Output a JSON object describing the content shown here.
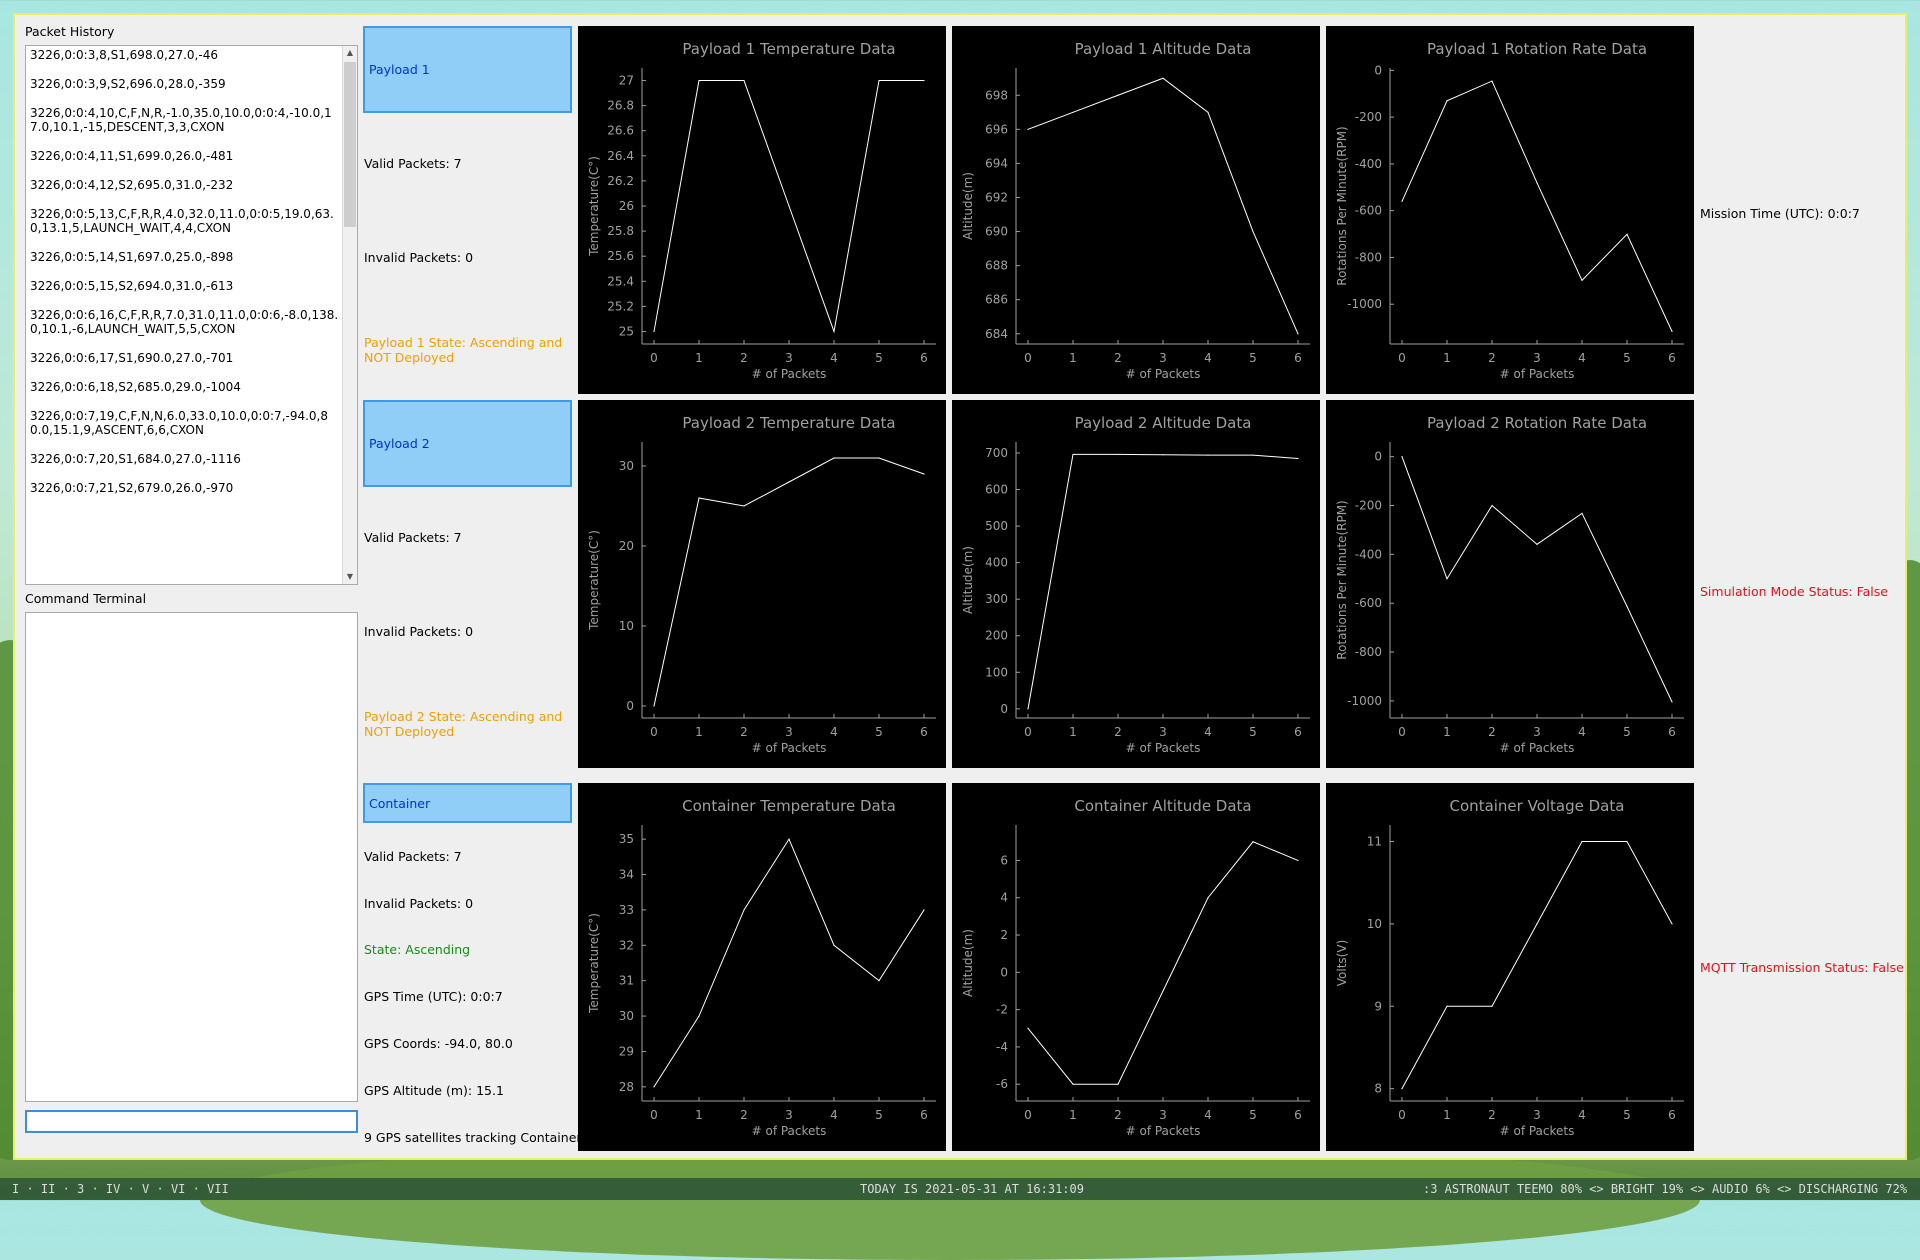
{
  "packet_history": {
    "label": "Packet History",
    "items": [
      "3226,0:0:3,8,S1,698.0,27.0,-46",
      "3226,0:0:3,9,S2,696.0,28.0,-359",
      "3226,0:0:4,10,C,F,N,R,-1.0,35.0,10.0,0:0:4,-10.0,17.0,10.1,-15,DESCENT,3,3,CXON",
      "3226,0:0:4,11,S1,699.0,26.0,-481",
      "3226,0:0:4,12,S2,695.0,31.0,-232",
      "3226,0:0:5,13,C,F,R,R,4.0,32.0,11.0,0:0:5,19.0,63.0,13.1,5,LAUNCH_WAIT,4,4,CXON",
      "3226,0:0:5,14,S1,697.0,25.0,-898",
      "3226,0:0:5,15,S2,694.0,31.0,-613",
      "3226,0:0:6,16,C,F,R,R,7.0,31.0,11.0,0:0:6,-8.0,138.0,10.1,-6,LAUNCH_WAIT,5,5,CXON",
      "3226,0:0:6,17,S1,690.0,27.0,-701",
      "3226,0:0:6,18,S2,685.0,29.0,-1004",
      "3226,0:0:7,19,C,F,N,N,6.0,33.0,10.0,0:0:7,-94.0,80.0,15.1,9,ASCENT,6,6,CXON",
      "3226,0:0:7,20,S1,684.0,27.0,-1116",
      "3226,0:0:7,21,S2,679.0,26.0,-970"
    ]
  },
  "command_terminal": {
    "label": "Command Terminal",
    "input_value": ""
  },
  "payload1": {
    "button": "Payload 1",
    "valid": "Valid Packets: 7",
    "invalid": "Invalid Packets: 0",
    "state": "Payload 1 State: Ascending and NOT Deployed"
  },
  "payload2": {
    "button": "Payload 2",
    "valid": "Valid Packets: 7",
    "invalid": "Invalid Packets: 0",
    "state": "Payload 2 State: Ascending and NOT Deployed"
  },
  "container": {
    "button": "Container",
    "valid": "Valid Packets: 7",
    "invalid": "Invalid Packets: 0",
    "state": "State: Ascending",
    "gps_time": "GPS Time (UTC): 0:0:7",
    "gps_coords": "GPS Coords: -94.0, 80.0",
    "gps_alt": "GPS Altitude (m): 15.1",
    "gps_sats": "9 GPS satellites tracking Container"
  },
  "right_status": {
    "mission_time": "Mission Time (UTC): 0:0:7",
    "sim_mode": "Simulation Mode Status: False",
    "mqtt": "MQTT Transmission Status: False"
  },
  "colors": {
    "button_bg": "#90cdf7",
    "button_text": "#0033cc",
    "warning": "#f0a000",
    "ok": "#1a8a1a",
    "error": "#e0141e",
    "chart_bg": "#000000",
    "chart_fg": "#a0a0a0",
    "line": "#ffffff"
  },
  "taskbar": {
    "workspaces": "I · II · 3 · IV · V · VI · VII",
    "date": "TODAY IS 2021-05-31 AT 16:31:09",
    "system": ":3 ASTRONAUT TEEMO 80% <> BRIGHT 19% <> AUDIO 6% <> DISCHARGING 72%"
  },
  "chart_data": [
    {
      "type": "line",
      "title": "Payload 1 Temperature Data",
      "xlabel": "# of Packets",
      "ylabel": "Temperature(C°)",
      "x": [
        0,
        1,
        2,
        3,
        4,
        5,
        6
      ],
      "values": [
        25,
        27,
        27,
        26,
        25,
        27,
        27
      ],
      "xlim": [
        0,
        6
      ],
      "ylim": [
        24.9,
        27.1
      ],
      "yticks": [
        25,
        25.2,
        25.4,
        25.6,
        25.8,
        26,
        26.2,
        26.4,
        26.6,
        26.8,
        27
      ]
    },
    {
      "type": "line",
      "title": "Payload 1 Altitude Data",
      "xlabel": "# of Packets",
      "ylabel": "Altitude(m)",
      "x": [
        0,
        1,
        2,
        3,
        4,
        5,
        6
      ],
      "values": [
        696,
        697,
        698,
        699,
        697,
        690,
        684
      ],
      "xlim": [
        0,
        6
      ],
      "ylim": [
        683.4,
        699.6
      ],
      "yticks": [
        684,
        686,
        688,
        690,
        692,
        694,
        696,
        698
      ]
    },
    {
      "type": "line",
      "title": "Payload 1 Rotation Rate Data",
      "xlabel": "# of Packets",
      "ylabel": "Rotations Per Minute(RPM)",
      "x": [
        0,
        1,
        2,
        3,
        4,
        5,
        6
      ],
      "values": [
        -560,
        -130,
        -46,
        -481,
        -898,
        -701,
        -1116
      ],
      "xlim": [
        0,
        6
      ],
      "ylim": [
        -1170,
        10
      ],
      "yticks": [
        0,
        -200,
        -400,
        -600,
        -800,
        -1000
      ]
    },
    {
      "type": "line",
      "title": "Payload 2 Temperature Data",
      "xlabel": "# of Packets",
      "ylabel": "Temperature(C°)",
      "x": [
        0,
        1,
        2,
        3,
        4,
        5,
        6
      ],
      "values": [
        0,
        26,
        25,
        28,
        31,
        31,
        29
      ],
      "xlim": [
        0,
        6
      ],
      "ylim": [
        -1.5,
        33
      ],
      "yticks": [
        0,
        10,
        20,
        30
      ]
    },
    {
      "type": "line",
      "title": "Payload 2 Altitude Data",
      "xlabel": "# of Packets",
      "ylabel": "Altitude(m)",
      "x": [
        0,
        1,
        2,
        3,
        4,
        5,
        6
      ],
      "values": [
        0,
        696,
        696,
        695,
        694,
        694,
        685
      ],
      "xlim": [
        0,
        6
      ],
      "ylim": [
        -25,
        730
      ],
      "yticks": [
        0,
        100,
        200,
        300,
        400,
        500,
        600,
        700
      ]
    },
    {
      "type": "line",
      "title": "Payload 2 Rotation Rate Data",
      "xlabel": "# of Packets",
      "ylabel": "Rotations Per Minute(RPM)",
      "x": [
        0,
        1,
        2,
        3,
        4,
        5,
        6
      ],
      "values": [
        0,
        -500,
        -200,
        -359,
        -232,
        -613,
        -1004
      ],
      "xlim": [
        0,
        6
      ],
      "ylim": [
        -1070,
        60
      ],
      "yticks": [
        0,
        -200,
        -400,
        -600,
        -800,
        -1000
      ]
    },
    {
      "type": "line",
      "title": "Container Temperature Data",
      "xlabel": "# of Packets",
      "ylabel": "Temperature(C°)",
      "x": [
        0,
        1,
        2,
        3,
        4,
        5,
        6
      ],
      "values": [
        28,
        30,
        33,
        35,
        32,
        31,
        33
      ],
      "xlim": [
        0,
        6
      ],
      "ylim": [
        27.6,
        35.4
      ],
      "yticks": [
        28,
        29,
        30,
        31,
        32,
        33,
        34,
        35
      ]
    },
    {
      "type": "line",
      "title": "Container Altitude Data",
      "xlabel": "# of Packets",
      "ylabel": "Altitude(m)",
      "x": [
        0,
        1,
        2,
        3,
        4,
        5,
        6
      ],
      "values": [
        -3,
        -6,
        -6,
        -1,
        4,
        7,
        6
      ],
      "xlim": [
        0,
        6
      ],
      "ylim": [
        -6.9,
        7.9
      ],
      "yticks": [
        -6,
        -4,
        -2,
        0,
        2,
        4,
        6
      ]
    },
    {
      "type": "line",
      "title": "Container Voltage Data",
      "xlabel": "# of Packets",
      "ylabel": "Volts(V)",
      "x": [
        0,
        1,
        2,
        3,
        4,
        5,
        6
      ],
      "values": [
        8,
        9,
        9,
        10,
        11,
        11,
        10
      ],
      "xlim": [
        0,
        6
      ],
      "ylim": [
        7.85,
        11.2
      ],
      "yticks": [
        8,
        9,
        10,
        11
      ]
    }
  ]
}
